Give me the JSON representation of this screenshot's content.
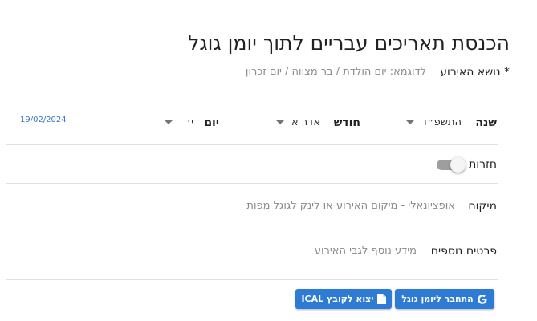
{
  "page": {
    "title": "הכנסת תאריכים עבריים לתוך יומן גוגל"
  },
  "subject": {
    "label": "* נושא האירוע",
    "placeholder": "לדוגמא: יום הולדת / בר מצווה / יום זכרון"
  },
  "date": {
    "year_label": "שנה",
    "year_value": "התשפ״ד",
    "month_label": "חודש",
    "month_value": "אדר א",
    "day_label": "יום",
    "day_value": "י׳",
    "gregorian": "19/02/2024"
  },
  "recurrence": {
    "label": "חזרות",
    "enabled": false
  },
  "location": {
    "label": "מיקום",
    "placeholder": "אופציונאלי - מיקום האירוע או לינק לגוגל מפות"
  },
  "details": {
    "label": "פרטים נוספים",
    "placeholder": "מידע נוסף לגבי האירוע"
  },
  "actions": {
    "connect_label": "התחבר ליומן גוגל",
    "connect_icon": "google-g-icon",
    "export_label": "יצוא לקובץ ICAL",
    "export_icon": "file-icon",
    "accent_color": "#2d7bd4"
  }
}
